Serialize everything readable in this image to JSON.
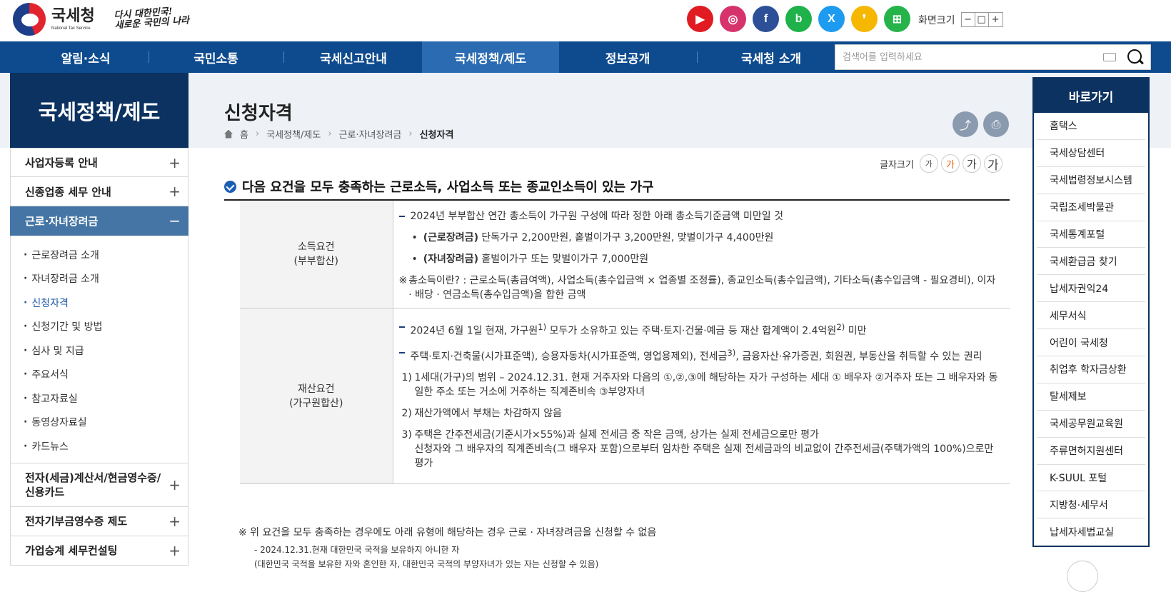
{
  "header": {
    "logo_name": "국세청",
    "logo_sub": "National Tax Service",
    "slogan_line1": "다시 대한민국!",
    "slogan_line2": "새로운 국민의 나라",
    "social": [
      {
        "icon": "youtube-icon",
        "color": "#e01b22",
        "glyph": "▶"
      },
      {
        "icon": "instagram-icon",
        "color": "#d6336c",
        "glyph": "◎"
      },
      {
        "icon": "facebook-icon",
        "color": "#2d4f98",
        "glyph": "f"
      },
      {
        "icon": "blog-icon",
        "color": "#1fb24a",
        "glyph": "b"
      },
      {
        "icon": "x-icon",
        "color": "#1d9bf0",
        "glyph": "X"
      },
      {
        "icon": "kakao-story-icon",
        "color": "#f5b700",
        "glyph": "❜"
      },
      {
        "icon": "band-icon",
        "color": "#25b34a",
        "glyph": "⊞"
      }
    ],
    "zoom_label": "화면크기",
    "zoom_buttons": [
      "−",
      "□",
      "+"
    ]
  },
  "nav": {
    "items": [
      "알림·소식",
      "국민소통",
      "국세신고안내",
      "국세정책/제도",
      "정보공개",
      "국세청 소개"
    ],
    "search_placeholder": "검색어를 입력하세요"
  },
  "sidebar": {
    "title": "국세정책/제도",
    "items_top": [
      "사업자등록 안내",
      "신종업종 세무 안내",
      "근로·자녀장려금"
    ],
    "sub_items": [
      "근로장려금 소개",
      "자녀장려금 소개",
      "신청자격",
      "신청기간 및 방법",
      "심사 및 지급",
      "주요서식",
      "참고자료실",
      "동영상자료실",
      "카드뉴스"
    ],
    "items_bottom": [
      "전자(세금)계산서/현금영수증/신용카드",
      "전자기부금영수증 제도",
      "가업승계 세무컨설팅"
    ],
    "plus": "+",
    "minus": "−"
  },
  "main": {
    "title": "신청자격",
    "breadcrumb": [
      "홈",
      "국세정책/제도",
      "근로·자녀장려금",
      "신청자격"
    ],
    "share_glyph": "⤴",
    "print_glyph": "⎙",
    "fontsize_label": "글자크기",
    "fontsize_options": [
      "가",
      "가",
      "가",
      "가"
    ],
    "section_heading": "다음 요건을 모두 충족하는 근로소득, 사업소득 또는 종교인소득이 있는 가구",
    "income": {
      "label1": "소득요건",
      "label2": "(부부합산)",
      "line1": "2024년 부부합산 연간 총소득이 가구원 구성에 따라 정한 아래 총소득기준금액 미만일 것",
      "bullet1_bold": "(근로장려금)",
      "bullet1_rest": " 단독가구 2,200만원, 홑벌이가구 3,200만원, 맞벌이가구 4,400만원",
      "bullet2_bold": "(자녀장려금)",
      "bullet2_rest": " 홑벌이가구 또는 맞벌이가구 7,000만원",
      "note_mark": "※",
      "note": "총소득이란? : 근로소득(총급여액), 사업소득(총수입금액 × 업종별 조정률), 종교인소득(총수입금액), 기타소득(총수입금액 - 필요경비), 이자 · 배당 · 연금소득(총수입금액)을 합한 금액"
    },
    "property": {
      "label1": "재산요건",
      "label2": "(가구원합산)",
      "line1_a": "2024년 6월 1일 현재, 가구원",
      "line1_sup1": "1)",
      "line1_b": " 모두가 소유하고 있는 주택·토지·건물·예금 등 재산 합계액이 2.4억원",
      "line1_sup2": "2)",
      "line1_c": " 미만",
      "line2_a": "주택·토지·건축물(시가표준액), 승용자동차(시가표준액, 영업용제외), 전세금",
      "line2_sup": "3)",
      "line2_b": ", 금융자산·유가증권, 회원권, 부동산을 취득할 수 있는 권리",
      "n1_no": "1)",
      "n1": "1세대(가구)의 범위 – 2024.12.31. 현재 거주자와 다음의 ①,②,③에 해당하는 자가 구성하는 세대 ① 배우자 ②거주자 또는 그 배우자와 동일한 주소 또는 거소에 거주하는 직계존비속 ③부양자녀",
      "n2_no": "2)",
      "n2": "재산가액에서 부채는 차감하지 않음",
      "n3_no": "3)",
      "n3_a": "주택은 간주전세금(기준시가×55%)과 실제 전세금 중 작은 금액, 상가는 실제 전세금으로만 평가",
      "n3_b": "신청자와 그 배우자의 직계존비속(그 배우자 포함)으로부터 임차한 주택은 실제 전세금과의 비교없이 간주전세금(주택가액의 100%)으로만 평가"
    },
    "extra_note": "※ 위 요건을 모두 충족하는 경우에도 아래 유형에 해당하는 경우 근로 · 자녀장려금을 신청할 수 없음",
    "extra_sub1": "- 2024.12.31.현재 대한민국 국적을 보유하지 아니한 자",
    "extra_sub2": "(대한민국 국적을 보유한 자와 혼인한 자, 대한민국 국적의 부양자녀가 있는 자는 신청할 수 있음)"
  },
  "quick": {
    "title": "바로가기",
    "items": [
      "홈택스",
      "국세상담센터",
      "국세법령정보시스템",
      "국립조세박물관",
      "국세통계포털",
      "국세환급금 찾기",
      "납세자권익24",
      "세무서식",
      "어린이 국세청",
      "취업후 학자금상환",
      "탈세제보",
      "국세공무원교육원",
      "주류면허지원센터",
      "K-SUUL 포털",
      "지방청·세무서",
      "납세자세법교실"
    ]
  },
  "colors": {
    "nav": "#0d4a8e",
    "nav_active": "#2a6bb2",
    "dark": "#0b3260",
    "sidebar_active": "#4475a4",
    "accent_orange": "#e25e00"
  }
}
